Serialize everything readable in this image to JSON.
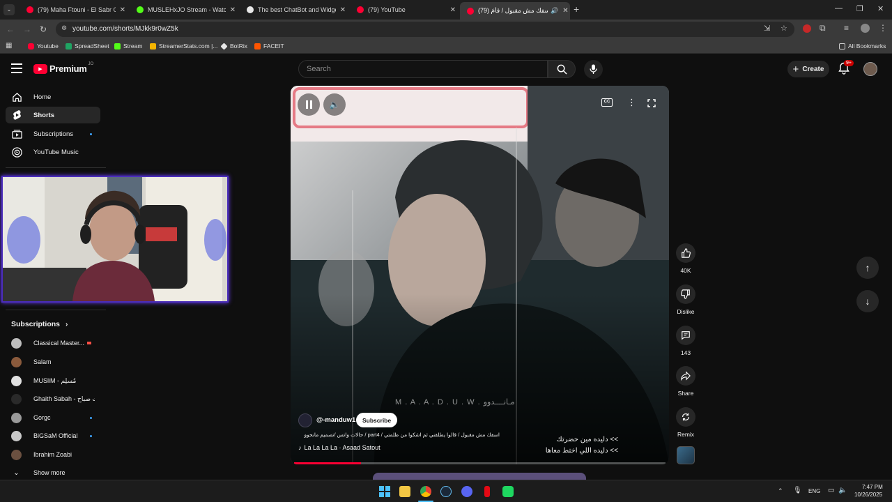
{
  "browser": {
    "tabs": [
      {
        "title": "(79) Maha Ftouni - El Sabr Gam",
        "favicon_color": "#ff0033"
      },
      {
        "title": "MUSLEHxJO Stream - Watch Li",
        "favicon_color": "#53fc18"
      },
      {
        "title": "The best ChatBot and Widgets",
        "favicon_color": "#e8e8e8"
      },
      {
        "title": "(79) YouTube",
        "favicon_color": "#ff0033"
      },
      {
        "title": "(79) اسفك مش مقبول / قأمَ",
        "favicon_color": "#ff0033"
      }
    ],
    "active_tab_index": 4,
    "url": "youtube.com/shorts/MJkk9r0wZ5k",
    "bookmarks": [
      {
        "label": "Youtube",
        "icon": "youtube-icon",
        "color": "#ff0033"
      },
      {
        "label": "SpreadSheet",
        "icon": "sheets-icon",
        "color": "#1fa463"
      },
      {
        "label": "Stream",
        "icon": "kick-icon",
        "color": "#53fc18"
      },
      {
        "label": "StreamerStats.com |...",
        "icon": "stats-icon",
        "color": "#f4b400"
      },
      {
        "label": "BotRix",
        "icon": "botrix-icon",
        "color": "#e8e8e8"
      },
      {
        "label": "FACEIT",
        "icon": "faceit-icon",
        "color": "#ff5500"
      }
    ],
    "all_bookmarks": "All Bookmarks"
  },
  "youtube": {
    "logo_text": "Premium",
    "logo_sup": "JO",
    "search_placeholder": "Search",
    "create_label": "Create",
    "notifications_badge": "9+",
    "brand_color": "#ff0033",
    "accent_color": "#3ea6ff"
  },
  "sidebar": {
    "items": [
      {
        "label": "Home",
        "icon": "home-icon"
      },
      {
        "label": "Shorts",
        "icon": "shorts-icon",
        "active": true
      },
      {
        "label": "Subscriptions",
        "icon": "subscriptions-icon"
      },
      {
        "label": "YouTube Music",
        "icon": "youtube-music-icon"
      }
    ],
    "subscriptions_heading": "Subscriptions",
    "subscriptions": [
      {
        "name": "Classical Master...",
        "avatar_color": "#bdbdbd"
      },
      {
        "name": "Salam",
        "avatar_color": "#8a5a3c"
      },
      {
        "name": "MUSliM - مُسلِم",
        "avatar_color": "#e0e0e0"
      },
      {
        "name": "Ghaith Sabah - غيث صباح",
        "avatar_color": "#2a2a2a"
      },
      {
        "name": "Gorgc",
        "avatar_color": "#9a9a9a"
      },
      {
        "name": "BiGSaM Official",
        "avatar_color": "#c8c8c8"
      },
      {
        "name": "Ibrahim Zoabi",
        "avatar_color": "#6b5040"
      }
    ],
    "show_more": "Show more"
  },
  "short": {
    "channel": "@-manduw1",
    "subscribe_label": "Subscribe",
    "caption": "اسفك مش مقبول / قالوا يطلقني ثم اشكوا من ظلمتي / part4 / حالات واتس /تصميم مانحوو",
    "sound": "La La La La · Asaad Satout",
    "overlay_watermark": "M . A . A . D . U . W .   مـانــــدوو",
    "subtitle_line1": ">> دليده مين حضرتك",
    "subtitle_line2": ">> دليده اللي اختط معاها",
    "progress": 0.18,
    "actions": [
      {
        "label": "40K",
        "icon": "like-icon"
      },
      {
        "label": "Dislike",
        "icon": "dislike-icon"
      },
      {
        "label": "143",
        "icon": "comment-icon"
      },
      {
        "label": "Share",
        "icon": "share-icon"
      },
      {
        "label": "Remix",
        "icon": "remix-icon"
      }
    ]
  },
  "taskbar": {
    "language": "ENG",
    "time": "7:47 PM",
    "date": "10/26/2025"
  }
}
